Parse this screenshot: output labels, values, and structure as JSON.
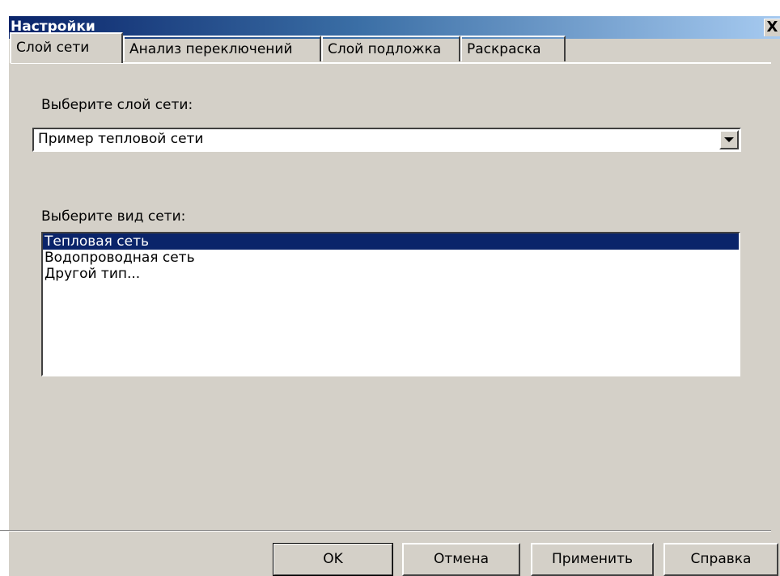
{
  "window": {
    "title": "Настройки",
    "close_glyph": "X"
  },
  "tabs": [
    {
      "label": "Слой сети",
      "active": true
    },
    {
      "label": "Анализ переключений",
      "active": false
    },
    {
      "label": "Слой подложка",
      "active": false
    },
    {
      "label": "Раскраска",
      "active": false
    }
  ],
  "layer_section": {
    "label": "Выберите слой сети:",
    "selected_value": "Пример тепловой сети",
    "dropdown_icon": "chevron-down-icon"
  },
  "network_type_section": {
    "label": "Выберите вид сети:",
    "items": [
      {
        "label": "Тепловая сеть",
        "selected": true
      },
      {
        "label": "Водопроводная сеть",
        "selected": false
      },
      {
        "label": "Другой тип...",
        "selected": false
      }
    ]
  },
  "buttons": {
    "ok": "OK",
    "cancel": "Отмена",
    "apply": "Применить",
    "help": "Справка"
  },
  "colors": {
    "dialog_bg": "#d4d0c8",
    "title_gradient_start": "#0a246a",
    "title_gradient_end": "#a6caf0",
    "selection_bg": "#0a246a",
    "selection_text": "#ffffff"
  }
}
